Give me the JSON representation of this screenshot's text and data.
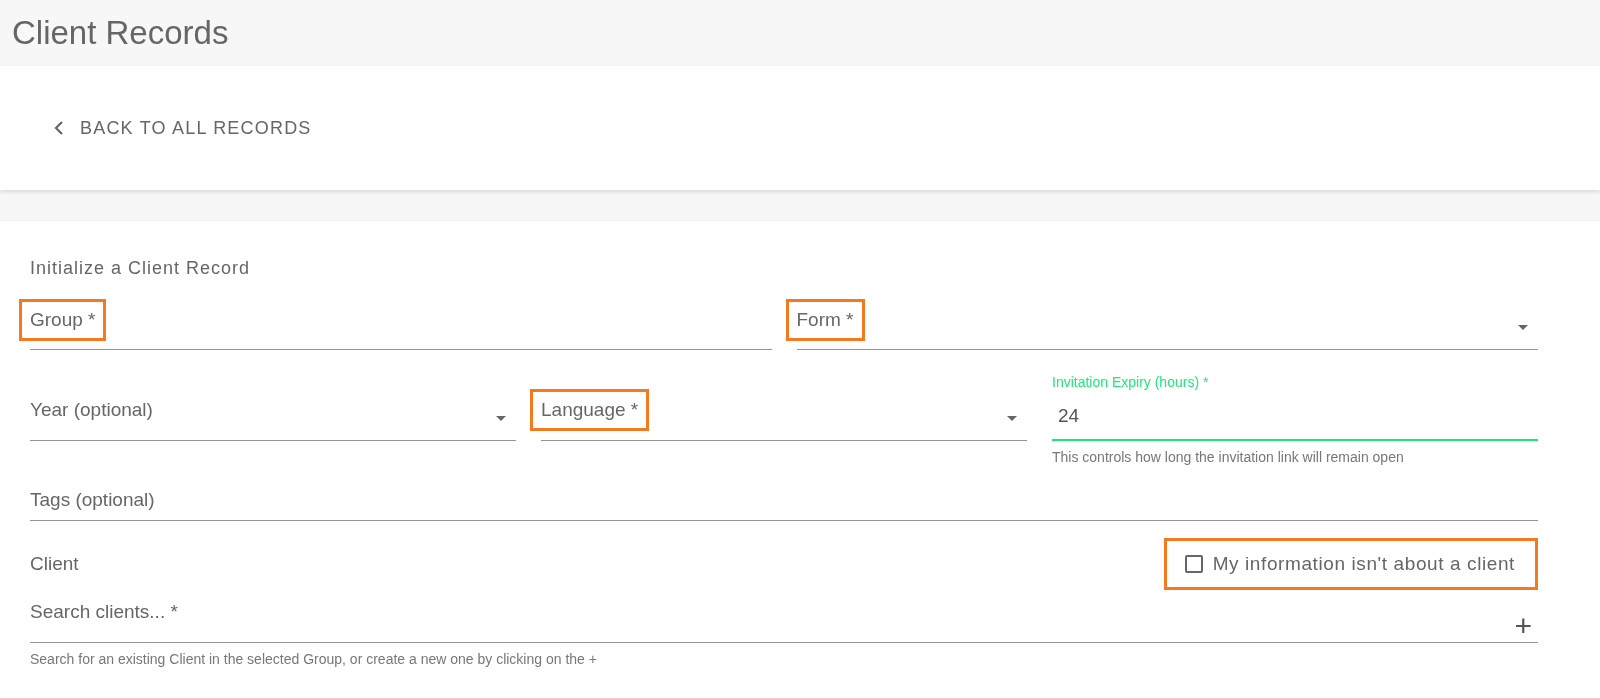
{
  "header": {
    "title": "Client Records"
  },
  "back_link": {
    "label": "BACK TO ALL RECORDS"
  },
  "form": {
    "title": "Initialize a Client Record",
    "rows": [
      [
        {
          "label": "Group *",
          "dropdown": false,
          "highlighted": true,
          "focused": false
        },
        {
          "label": "Form *",
          "dropdown": true,
          "highlighted": true,
          "focused": false
        }
      ],
      [
        {
          "label": "Year (optional)",
          "dropdown": true,
          "highlighted": false,
          "focused": false
        },
        {
          "label": "Language *",
          "dropdown": true,
          "highlighted": true,
          "focused": false
        },
        {
          "label": "Invitation Expiry (hours) *",
          "value": "24",
          "helper": "This controls how long the invitation link will remain open",
          "dropdown": false,
          "highlighted": false,
          "focused": true
        }
      ],
      [
        {
          "label": "Tags (optional)",
          "dropdown": false,
          "highlighted": false,
          "focused": false
        }
      ]
    ],
    "client": {
      "title": "Client",
      "checkbox": {
        "label": "My information isn't about a client",
        "checked": false,
        "highlighted": true
      },
      "search": {
        "placeholder": "Search clients... *",
        "add_symbol": "+",
        "helper": "Search for an existing Client in the selected Group, or create a new one by clicking on the +"
      }
    }
  }
}
